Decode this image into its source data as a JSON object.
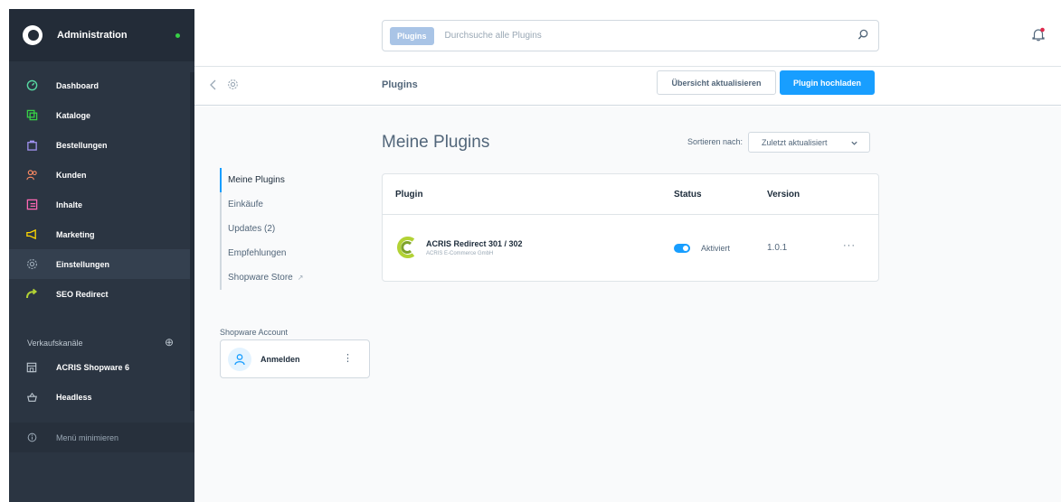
{
  "sidebar": {
    "title": "Administration",
    "items": [
      {
        "label": "Dashboard",
        "icon": "gauge-icon",
        "color": "#57d9a3"
      },
      {
        "label": "Kataloge",
        "icon": "catalog-icon",
        "color": "#37d046"
      },
      {
        "label": "Bestellungen",
        "icon": "shopping-bag-icon",
        "color": "#a092f0"
      },
      {
        "label": "Kunden",
        "icon": "users-icon",
        "color": "#f88962"
      },
      {
        "label": "Inhalte",
        "icon": "content-icon",
        "color": "#ff68b4"
      },
      {
        "label": "Marketing",
        "icon": "megaphone-icon",
        "color": "#ffd700"
      },
      {
        "label": "Einstellungen",
        "icon": "gear-icon",
        "color": "#9aa8b5"
      },
      {
        "label": "SEO Redirect",
        "icon": "redirect-icon",
        "color": "#b2d235"
      }
    ],
    "channels_heading": "Verkaufskanäle",
    "channels": [
      {
        "label": "ACRIS Shopware 6",
        "icon": "storefront-icon"
      },
      {
        "label": "Headless",
        "icon": "basket-icon"
      }
    ],
    "minimize_label": "Menü minimieren"
  },
  "search": {
    "tag": "Plugins",
    "placeholder": "Durchsuche alle Plugins"
  },
  "smartbar": {
    "title": "Plugins",
    "refresh_label": "Übersicht aktualisieren",
    "upload_label": "Plugin hochladen"
  },
  "tabs": [
    {
      "label": "Meine Plugins"
    },
    {
      "label": "Einkäufe"
    },
    {
      "label": "Updates (2)"
    },
    {
      "label": "Empfehlungen"
    },
    {
      "label": "Shopware Store"
    }
  ],
  "account": {
    "title": "Shopware Account",
    "login_label": "Anmelden"
  },
  "main": {
    "title": "Meine Plugins",
    "sort_label": "Sortieren nach:",
    "sort_value": "Zuletzt aktualisiert"
  },
  "table": {
    "headers": {
      "plugin": "Plugin",
      "status": "Status",
      "version": "Version"
    },
    "rows": [
      {
        "name": "ACRIS Redirect 301 / 302",
        "vendor": "ACRIS E-Commerce GmbH",
        "status": "Aktiviert",
        "version": "1.0.1"
      }
    ]
  },
  "colors": {
    "accent": "#189eff",
    "sidebar_bg": "#2b3542",
    "brand_green": "#b2d235"
  }
}
